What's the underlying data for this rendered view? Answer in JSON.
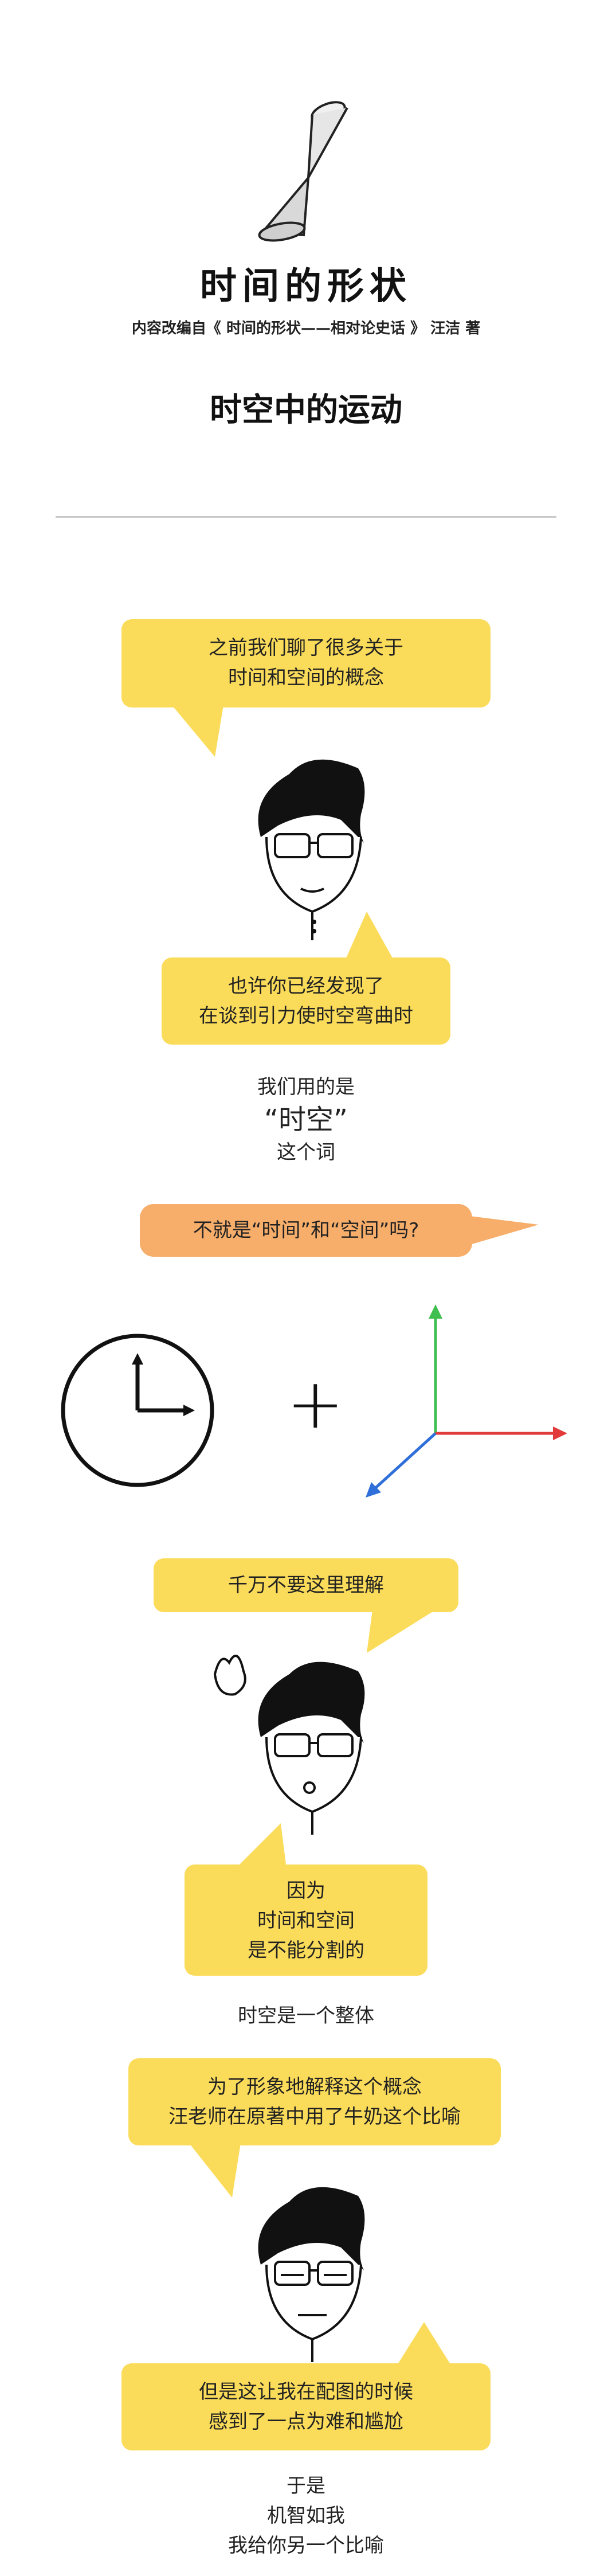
{
  "header": {
    "title": "时间的形状",
    "subtitle": "内容改编自《 时间的形状——相对论史话 》 汪洁 著",
    "section_title": "时空中的运动"
  },
  "dialog": {
    "b1": [
      "之前我们聊了很多关于",
      "时间和空间的概念"
    ],
    "b2": [
      "也许你已经发现了",
      "在谈到引力使时空弯曲时"
    ],
    "t1": [
      "我们用的是",
      "“时空”",
      "这个词"
    ],
    "b3": "不就是“时间”和“空间”吗?",
    "plus": "+",
    "b4": "千万不要这里理解",
    "b5": [
      "因为",
      "时间和空间",
      "是不能分割的"
    ],
    "t2": "时空是一个整体",
    "b6": [
      "为了形象地解释这个概念",
      "汪老师在原著中用了牛奶这个比喻"
    ],
    "b7": [
      "但是这让我在配图的时候",
      "感到了一点为难和尴尬"
    ],
    "t3": [
      "于是",
      "机智如我",
      "我给你另一个比喻"
    ]
  },
  "colors": {
    "bubble_yellow": "#fbdc5a",
    "bubble_orange": "#f7ae6b",
    "axis_x": "#e23b3b",
    "axis_y": "#3fbf4f",
    "axis_z": "#2f6fd9"
  }
}
